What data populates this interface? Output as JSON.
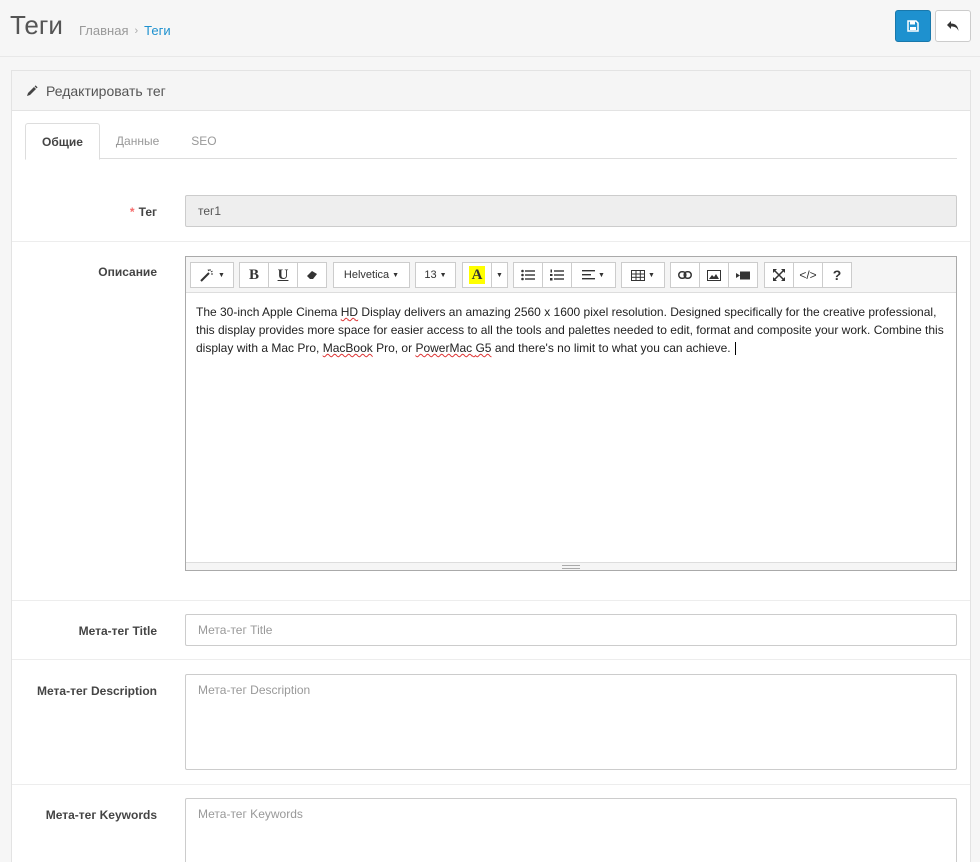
{
  "header": {
    "title": "Теги",
    "breadcrumb": {
      "home": "Главная",
      "separator": "›",
      "current": "Теги"
    },
    "save_icon": "floppy-disk-icon",
    "back_icon": "reply-arrow-icon"
  },
  "panel": {
    "title": "Редактировать тег",
    "title_icon": "pencil-icon"
  },
  "tabs": [
    {
      "label": "Общие",
      "active": true
    },
    {
      "label": "Данные",
      "active": false
    },
    {
      "label": "SEO",
      "active": false
    }
  ],
  "form": {
    "tag": {
      "required_mark": "*",
      "label": "Тег",
      "value": "тег1"
    },
    "description": {
      "label": "Описание",
      "toolbar": {
        "font": "Helvetica",
        "size": "13",
        "highlight_letter": "A",
        "bold": "B",
        "underline": "U",
        "help": "?",
        "code": "</>"
      },
      "text": {
        "part1": "The 30-inch Apple Cinema ",
        "hd": "HD",
        "part2": " Display delivers an amazing 2560 x 1600 pixel resolution. Designed specifically for the creative professional, this display provides more space for easier access to all the tools and palettes needed to edit, format and composite your work. Combine this display with a Mac Pro, ",
        "macbook": "MacBook",
        "part3": " Pro, or ",
        "powermac": "PowerMac",
        "sp": " ",
        "g5": "G5",
        "part4": " and there's no limit to what you can achieve."
      }
    },
    "meta_title": {
      "label": "Мета-тег Title",
      "placeholder": "Мета-тег Title"
    },
    "meta_description": {
      "label": "Мета-тег Description",
      "placeholder": "Мета-тег Description"
    },
    "meta_keywords": {
      "label": "Мета-тег Keywords",
      "placeholder": "Мета-тег Keywords"
    }
  },
  "colors": {
    "primary": "#1e91cf",
    "required": "#f56b6b",
    "highlight": "#ffff00"
  }
}
